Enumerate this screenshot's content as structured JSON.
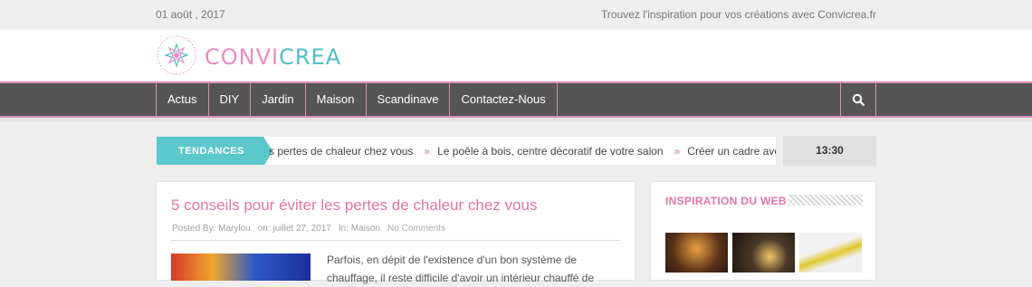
{
  "topbar": {
    "date": "01 août , 2017",
    "tagline": "Trouvez l'inspiration pour vos créations avec Convicrea.fr"
  },
  "logo": {
    "part1": "CONVI",
    "part2": "CREA",
    "badge": "CONVICREA"
  },
  "nav": {
    "items": [
      "Actus",
      "DIY",
      "Jardin",
      "Maison",
      "Scandinave",
      "Contactez-Nous"
    ],
    "search_icon": "search-icon"
  },
  "trending": {
    "label": "TENDANCES",
    "items": [
      "s pertes de chaleur chez vous",
      "Le poêle à bois, centre décoratif de votre salon",
      "Créer un cadre avec du pap"
    ],
    "time": "13:30"
  },
  "post": {
    "title": "5 conseils pour éviter les pertes de chaleur chez vous",
    "author": "Posted By: Marylou",
    "date": "on: juillet 27, 2017",
    "category": "In: Maison",
    "comments": "No Comments",
    "excerpt": "Parfois, en dépit de l'existence d'un bon système de chauffage, il reste difficile d'avoir un intérieur chauffé de"
  },
  "sidebar": {
    "title": "INSPIRATION DU WEB"
  },
  "colors": {
    "pink": "#e273a8",
    "teal": "#5bc8cb",
    "navbar": "#555555"
  }
}
